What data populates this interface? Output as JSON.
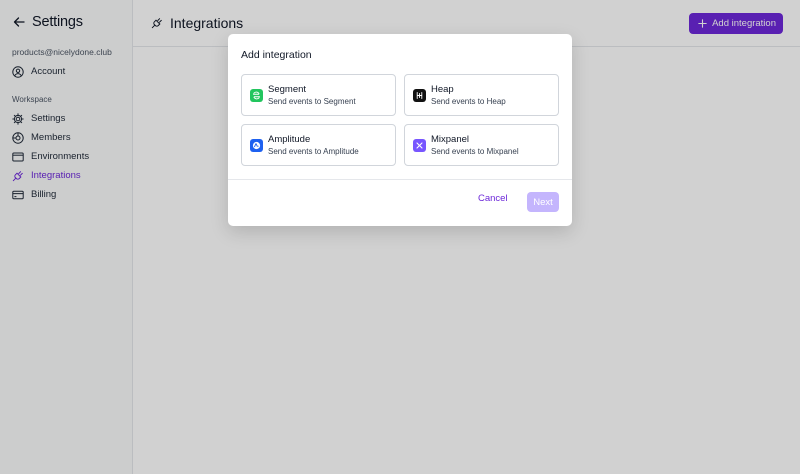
{
  "sidebar": {
    "title": "Settings",
    "email": "products@nicelydone.club",
    "account_label": "Account",
    "workspace_label": "Workspace",
    "items": [
      {
        "label": "Settings",
        "icon": "gear-icon"
      },
      {
        "label": "Members",
        "icon": "members-icon"
      },
      {
        "label": "Environments",
        "icon": "window-icon"
      },
      {
        "label": "Integrations",
        "icon": "plug-icon",
        "active": true
      },
      {
        "label": "Billing",
        "icon": "card-icon"
      }
    ]
  },
  "header": {
    "title": "Integrations",
    "add_button_label": "Add integration"
  },
  "modal": {
    "title": "Add integration",
    "options": [
      {
        "name": "Segment",
        "description": "Send events to Segment",
        "color": "#22c55e"
      },
      {
        "name": "Heap",
        "description": "Send events to Heap",
        "color": "#111111"
      },
      {
        "name": "Amplitude",
        "description": "Send events to Amplitude",
        "color": "#1e61f0"
      },
      {
        "name": "Mixpanel",
        "description": "Send events to Mixpanel",
        "color": "#7856ff"
      }
    ],
    "cancel_label": "Cancel",
    "next_label": "Next"
  },
  "colors": {
    "accent": "#6d28d9",
    "next_disabled": "#c4b5fd"
  }
}
